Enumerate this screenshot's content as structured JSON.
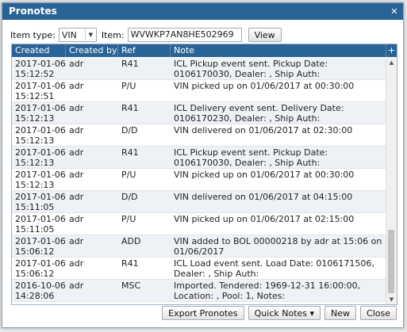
{
  "dialog": {
    "title": "Pronotes",
    "close_icon": "✕"
  },
  "filter": {
    "item_type_label": "Item type:",
    "item_type_value": "VIN",
    "item_label": "Item:",
    "item_value": "WVWKP7AN8HE502969",
    "view_label": "View"
  },
  "grid": {
    "columns": [
      "Created",
      "Created by",
      "Ref",
      "Note"
    ],
    "add_icon": "+",
    "rows": [
      {
        "created": "2017-01-06 15:12:52",
        "by": "adr",
        "ref": "R41",
        "note": "ICL Pickup event sent. Pickup Date: 0106170030, Dealer: , Ship Auth:"
      },
      {
        "created": "2017-01-06 15:12:51",
        "by": "adr",
        "ref": "P/U",
        "note": "VIN picked up on 01/06/2017 at 00:30:00"
      },
      {
        "created": "2017-01-06 15:12:13",
        "by": "adr",
        "ref": "R41",
        "note": "ICL Delivery event sent. Delivery Date: 0106170230, Dealer: , Ship Auth:"
      },
      {
        "created": "2017-01-06 15:12:13",
        "by": "adr",
        "ref": "D/D",
        "note": "VIN delivered on 01/06/2017 at 02:30:00"
      },
      {
        "created": "2017-01-06 15:12:13",
        "by": "adr",
        "ref": "R41",
        "note": "ICL Pickup event sent. Pickup Date: 0106170030, Dealer: , Ship Auth:"
      },
      {
        "created": "2017-01-06 15:12:13",
        "by": "adr",
        "ref": "P/U",
        "note": "VIN picked up on 01/06/2017 at 00:30:00"
      },
      {
        "created": "2017-01-06 15:11:05",
        "by": "adr",
        "ref": "D/D",
        "note": "VIN delivered on 01/06/2017 at 04:15:00"
      },
      {
        "created": "2017-01-06 15:11:05",
        "by": "adr",
        "ref": "P/U",
        "note": "VIN picked up on 01/06/2017 at 02:15:00"
      },
      {
        "created": "2017-01-06 15:06:12",
        "by": "adr",
        "ref": "ADD",
        "note": "VIN added to BOL 00000218 by adr at 15:06 on 01/06/2017"
      },
      {
        "created": "2017-01-06 15:06:12",
        "by": "adr",
        "ref": "R41",
        "note": "ICL Load event sent. Load Date: 0106171506, Dealer: , Ship Auth:"
      },
      {
        "created": "2016-10-06 14:28:06",
        "by": "adr",
        "ref": "MSC",
        "note": "Imported. Tendered: 1969-12-31 16:00:00, Location: , Pool: 1, Notes:"
      }
    ]
  },
  "footer": {
    "export_label": "Export Pronotes",
    "quick_notes_label": "Quick Notes ▾",
    "new_label": "New",
    "close_label": "Close"
  },
  "scrollbar": {
    "up_icon": "▲",
    "down_icon": "▼"
  }
}
